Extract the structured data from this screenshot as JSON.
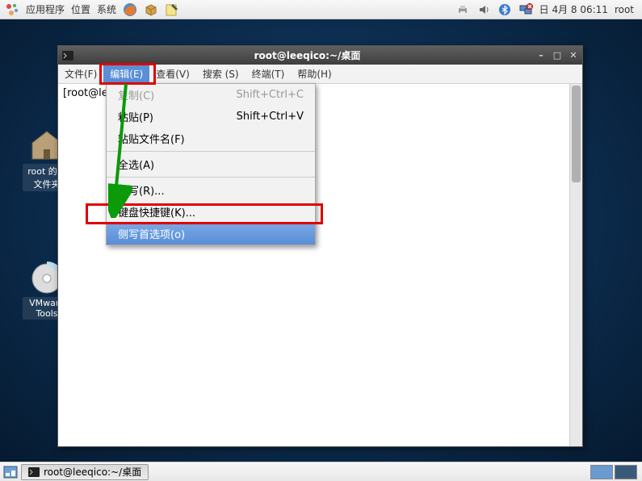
{
  "top_panel": {
    "apps": "应用程序",
    "places": "位置",
    "system": "系统",
    "clock": "日 4月  8 06:11",
    "user": "root"
  },
  "desktop_icons": {
    "icon1": "root 的主文件夹",
    "icon2": "VMware Tools"
  },
  "terminal": {
    "title": "root@leeqico:~/桌面",
    "menubar": {
      "file": "文件(F)",
      "edit": "编辑(E)",
      "view": "查看(V)",
      "search": "搜索 (S)",
      "terminal": "终端(T)",
      "help": "帮助(H)"
    },
    "prompt": "[root@le"
  },
  "dropdown": {
    "copy": "复制(C)",
    "copy_shortcut": "Shift+Ctrl+C",
    "paste": "粘贴(P)",
    "paste_shortcut": "Shift+Ctrl+V",
    "paste_filenames": "粘贴文件名(F)",
    "select_all": "全选(A)",
    "profiles": "侧写(R)...",
    "keyboard_shortcuts": "键盘快捷键(K)...",
    "profile_preferences": "侧写首选项(o)"
  },
  "bottom_panel": {
    "task1": "root@leeqico:~/桌面"
  }
}
